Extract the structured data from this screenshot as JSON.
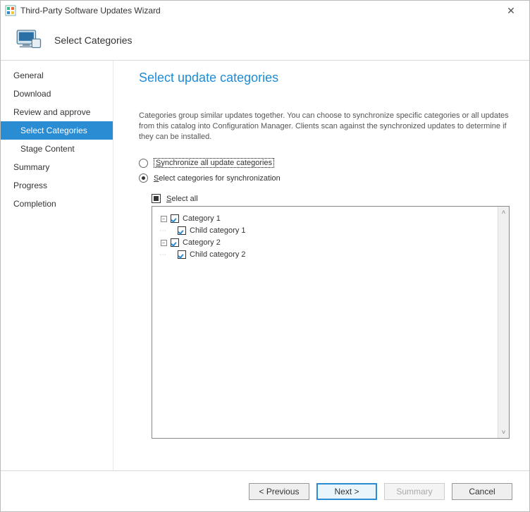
{
  "window": {
    "title": "Third-Party Software Updates Wizard",
    "close_glyph": "✕"
  },
  "banner": {
    "step_title": "Select Categories"
  },
  "nav": {
    "items": [
      {
        "label": "General",
        "kind": "top",
        "selected": false
      },
      {
        "label": "Download",
        "kind": "top",
        "selected": false
      },
      {
        "label": "Review and approve",
        "kind": "top",
        "selected": false
      },
      {
        "label": "Select Categories",
        "kind": "sub",
        "selected": true
      },
      {
        "label": "Stage Content",
        "kind": "sub",
        "selected": false
      },
      {
        "label": "Summary",
        "kind": "top",
        "selected": false
      },
      {
        "label": "Progress",
        "kind": "top",
        "selected": false
      },
      {
        "label": "Completion",
        "kind": "top",
        "selected": false
      }
    ]
  },
  "page": {
    "title": "Select update categories",
    "description": "Categories group similar updates together. You can choose to synchronize specific categories or all updates from this catalog into Configuration Manager. Clients scan against the synchronized updates to determine if they can be installed.",
    "radio_all_prefix": "S",
    "radio_all_rest": "ynchronize all update categories",
    "radio_select_prefix": "S",
    "radio_select_rest": "elect categories for synchronization",
    "selectall_prefix": "S",
    "selectall_rest": "elect all",
    "tree": [
      {
        "label": "Category 1",
        "level": 0,
        "checked": true
      },
      {
        "label": "Child category 1",
        "level": 1,
        "checked": true
      },
      {
        "label": "Category 2",
        "level": 0,
        "checked": true
      },
      {
        "label": "Child category 2",
        "level": 1,
        "checked": true
      }
    ]
  },
  "footer": {
    "previous": "< Previous",
    "next": "Next >",
    "summary": "Summary",
    "cancel": "Cancel"
  }
}
